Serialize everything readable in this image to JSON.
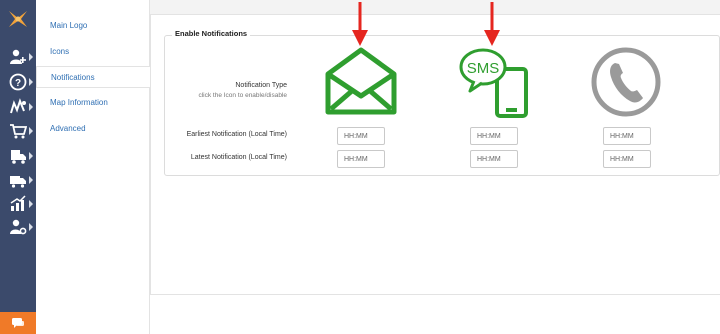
{
  "sidebar": {
    "icons": [
      "logo-icon",
      "add-user-icon",
      "help-icon",
      "routes-icon",
      "cart-icon",
      "delivery-icon",
      "reports-icon",
      "user-settings-icon"
    ],
    "chat_icon": "chat-icon"
  },
  "subnav": {
    "items": [
      {
        "label": "Main Logo"
      },
      {
        "label": "Icons"
      },
      {
        "label": "Notifications",
        "active": true
      },
      {
        "label": "Map Information"
      },
      {
        "label": "Advanced"
      }
    ]
  },
  "section": {
    "legend": "Enable Notifications",
    "notification_type_label": "Notification Type",
    "notification_type_hint": "click the Icon to enable/disable",
    "earliest_label": "Earliest Notification (Local Time)",
    "latest_label": "Latest Notification (Local Time)",
    "channels": [
      {
        "name": "email",
        "icon": "envelope-icon",
        "enabled": true,
        "earliest_placeholder": "HH:MM",
        "latest_placeholder": "HH:MM"
      },
      {
        "name": "sms",
        "icon": "sms-phone-icon",
        "sms_text": "SMS",
        "enabled": true,
        "earliest_placeholder": "HH:MM",
        "latest_placeholder": "HH:MM"
      },
      {
        "name": "voice",
        "icon": "phone-handset-icon",
        "enabled": false,
        "earliest_placeholder": "HH:MM",
        "latest_placeholder": "HH:MM"
      }
    ]
  },
  "colors": {
    "rail": "#3b4a6b",
    "accent_green": "#2f9e2f",
    "disabled_gray": "#9a9a9a",
    "arrow_red": "#e5261f",
    "chat_orange": "#f07a28",
    "link_blue": "#2f6fb3"
  }
}
